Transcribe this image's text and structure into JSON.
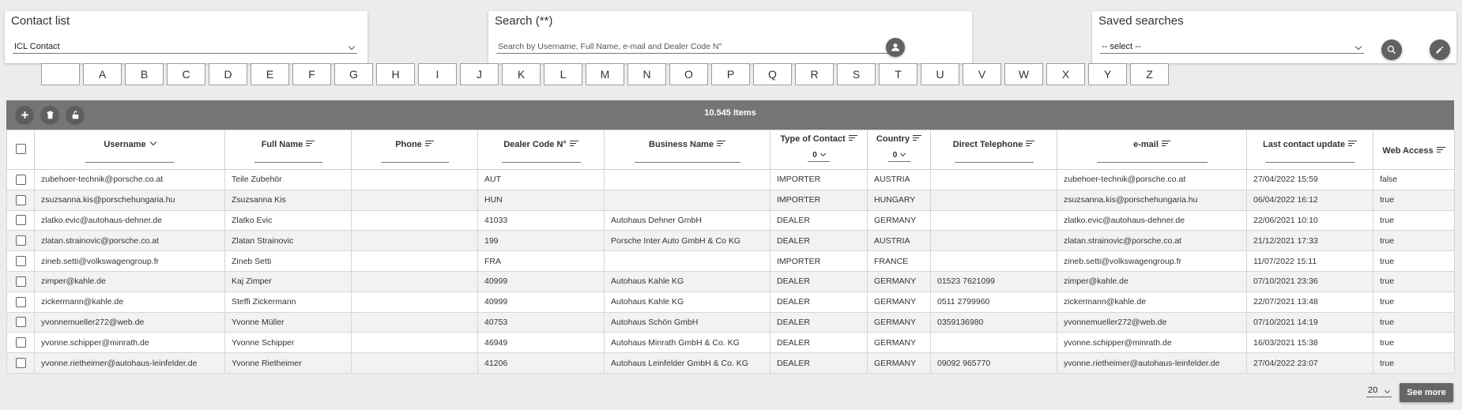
{
  "contact_list": {
    "title": "Contact list",
    "selected": "ICL Contact"
  },
  "search": {
    "title": "Search (**)",
    "placeholder": "Search by Username, Full Name, e-mail and Dealer Code N°",
    "icon": "person-icon"
  },
  "saved_searches": {
    "title": "Saved searches",
    "selected": "-- select --"
  },
  "letters": [
    "",
    "A",
    "B",
    "C",
    "D",
    "E",
    "F",
    "G",
    "H",
    "I",
    "J",
    "K",
    "L",
    "M",
    "N",
    "O",
    "P",
    "Q",
    "R",
    "S",
    "T",
    "U",
    "V",
    "W",
    "X",
    "Y",
    "Z"
  ],
  "toolbar": {
    "items_count": "10.545 Items",
    "actions": [
      "add-icon",
      "delete-icon",
      "unlock-icon"
    ]
  },
  "columns": [
    {
      "key": "username",
      "label": "Username"
    },
    {
      "key": "full_name",
      "label": "Full Name"
    },
    {
      "key": "phone",
      "label": "Phone"
    },
    {
      "key": "dealer_code",
      "label": "Dealer Code N°"
    },
    {
      "key": "business_name",
      "label": "Business Name"
    },
    {
      "key": "type",
      "label": "Type of Contact",
      "filter_value": "0"
    },
    {
      "key": "country",
      "label": "Country",
      "filter_value": "0"
    },
    {
      "key": "direct_phone",
      "label": "Direct Telephone"
    },
    {
      "key": "email",
      "label": "e-mail"
    },
    {
      "key": "last_update",
      "label": "Last contact update"
    },
    {
      "key": "web_access",
      "label": "Web Access"
    }
  ],
  "rows": [
    [
      "zubehoer-technik@porsche.co.at",
      "Teile Zubehör",
      "",
      "AUT",
      "",
      "IMPORTER",
      "AUSTRIA",
      "",
      "zubehoer-technik@porsche.co.at",
      "27/04/2022 15:59",
      "false"
    ],
    [
      "zsuzsanna.kis@porschehungaria.hu",
      "Zsuzsanna Kis",
      "",
      "HUN",
      "",
      "IMPORTER",
      "HUNGARY",
      "",
      "zsuzsanna.kis@porschehungaria.hu",
      "06/04/2022 16:12",
      "true"
    ],
    [
      "zlatko.evic@autohaus-dehner.de",
      "Zlatko Evic",
      "",
      "41033",
      "Autohaus Dehner GmbH",
      "DEALER",
      "GERMANY",
      "",
      "zlatko.evic@autohaus-dehner.de",
      "22/06/2021 10:10",
      "true"
    ],
    [
      "zlatan.strainovic@porsche.co.at",
      "Zlatan Strainovic",
      "",
      "199",
      "Porsche Inter Auto GmbH & Co KG",
      "DEALER",
      "AUSTRIA",
      "",
      "zlatan.strainovic@porsche.co.at",
      "21/12/2021 17:33",
      "true"
    ],
    [
      "zineb.setti@volkswagengroup.fr",
      "Zineb Setti",
      "",
      "FRA",
      "",
      "IMPORTER",
      "FRANCE",
      "",
      "zineb.setti@volkswagengroup.fr",
      "11/07/2022 15:11",
      "true"
    ],
    [
      "zimper@kahle.de",
      "Kaj Zimper",
      "",
      "40999",
      "Autohaus Kahle KG",
      "DEALER",
      "GERMANY",
      "01523 7621099",
      "zimper@kahle.de",
      "07/10/2021 23:36",
      "true"
    ],
    [
      "zickermann@kahle.de",
      "Steffi Zickermann",
      "",
      "40999",
      "Autohaus Kahle KG",
      "DEALER",
      "GERMANY",
      "0511 2799960",
      "zickermann@kahle.de",
      "22/07/2021 13:48",
      "true"
    ],
    [
      "yvonnemueller272@web.de",
      "Yvonne Müller",
      "",
      "40753",
      "Autohaus Schön GmbH",
      "DEALER",
      "GERMANY",
      "0359136980",
      "yvonnemueller272@web.de",
      "07/10/2021 14:19",
      "true"
    ],
    [
      "yvonne.schipper@minrath.de",
      "Yvonne Schipper",
      "",
      "46949",
      "Autohaus Minrath GmbH & Co. KG",
      "DEALER",
      "GERMANY",
      "",
      "yvonne.schipper@minrath.de",
      "16/03/2021 15:38",
      "true"
    ],
    [
      "yvonne.rietheimer@autohaus-leinfelder.de",
      "Yvonne Rietheimer",
      "",
      "41206",
      "Autohaus Leinfelder GmbH & Co. KG",
      "DEALER",
      "GERMANY",
      "09092 965770",
      "yvonne.rietheimer@autohaus-leinfelder.de",
      "27/04/2022 23:07",
      "true"
    ]
  ],
  "pagination": {
    "page_size": "20",
    "see_more": "See more"
  }
}
